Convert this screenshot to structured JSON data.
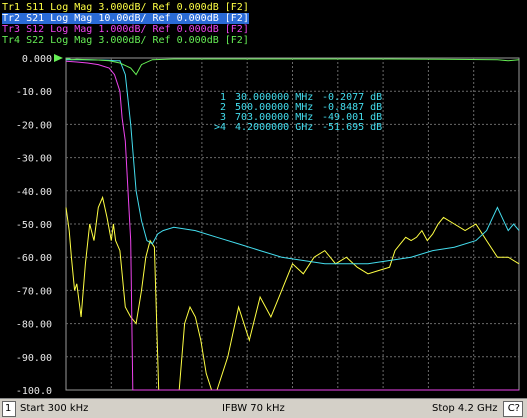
{
  "traces": [
    {
      "label": "Tr1 S11 Log Mag 3.000dB/ Ref 0.000dB [F2]",
      "color": "#ffff44",
      "selected": false
    },
    {
      "label": "Tr2 S21 Log Mag 10.00dB/ Ref 0.000dB [F2]",
      "color": "#44ddee",
      "selected": true
    },
    {
      "label": "Tr3 S12 Log Mag 1.000dB/ Ref 0.000dB [F2]",
      "color": "#ee44ee",
      "selected": false
    },
    {
      "label": "Tr4 S22 Log Mag 3.000dB/ Ref 0.000dB [F2]",
      "color": "#66ee55",
      "selected": false
    }
  ],
  "markers": [
    {
      "number": "1",
      "freq": "30.000000 MHz",
      "value": "-0.2077 dB"
    },
    {
      "number": "2",
      "freq": "500.00000 MHz",
      "value": "-0.8487 dB"
    },
    {
      "number": "3",
      "freq": "703.00000 MHz",
      "value": "-49.001 dB"
    },
    {
      "number": ">4",
      "freq": "4.2000000 GHz",
      "value": "-51.695 dB"
    }
  ],
  "status": {
    "channel": "1",
    "start": "Start 300 kHz",
    "ifbw": "IFBW 70 kHz",
    "stop": "Stop 4.2 GHz",
    "cal": "C?"
  },
  "chart_data": {
    "type": "line",
    "xlim": [
      0.0003,
      4.2
    ],
    "x_unit": "GHz",
    "ylim": [
      -100,
      0
    ],
    "yticks": [
      "0.000",
      "-10.00",
      "-20.00",
      "-30.00",
      "-40.00",
      "-50.00",
      "-60.00",
      "-70.00",
      "-80.00",
      "-90.00",
      "-100.0"
    ],
    "grid": true,
    "series": [
      {
        "name": "S11",
        "color": "#ffff44",
        "x": [
          0.0003,
          0.03,
          0.05,
          0.08,
          0.1,
          0.14,
          0.18,
          0.22,
          0.26,
          0.3,
          0.34,
          0.38,
          0.42,
          0.44,
          0.46,
          0.5,
          0.55,
          0.6,
          0.65,
          0.7,
          0.74,
          0.78,
          0.82,
          0.86,
          0.9,
          0.95,
          1.0,
          1.05,
          1.1,
          1.15,
          1.2,
          1.25,
          1.3,
          1.35,
          1.4,
          1.5,
          1.6,
          1.7,
          1.8,
          1.9,
          2.0,
          2.1,
          2.2,
          2.3,
          2.4,
          2.5,
          2.6,
          2.7,
          2.8,
          2.9,
          3.0,
          3.05,
          3.1,
          3.15,
          3.2,
          3.25,
          3.3,
          3.35,
          3.4,
          3.45,
          3.5,
          3.6,
          3.7,
          3.8,
          3.9,
          4.0,
          4.1,
          4.2
        ],
        "y": [
          -45,
          -52,
          -60,
          -70,
          -68,
          -78,
          -62,
          -50,
          -55,
          -45,
          -42,
          -48,
          -55,
          -50,
          -55,
          -58,
          -75,
          -78,
          -80,
          -70,
          -60,
          -55,
          -57,
          -100,
          -100,
          -100,
          -100,
          -100,
          -80,
          -75,
          -78,
          -85,
          -95,
          -100,
          -100,
          -90,
          -75,
          -85,
          -72,
          -78,
          -70,
          -62,
          -65,
          -60,
          -58,
          -62,
          -60,
          -63,
          -65,
          -64,
          -63,
          -58,
          -56,
          -54,
          -55,
          -54,
          -52,
          -55,
          -53,
          -50,
          -48,
          -50,
          -52,
          -50,
          -55,
          -60,
          -60,
          -62
        ]
      },
      {
        "name": "S21",
        "color": "#44ddee",
        "x": [
          0.0003,
          0.05,
          0.1,
          0.2,
          0.3,
          0.4,
          0.45,
          0.5,
          0.55,
          0.6,
          0.65,
          0.7,
          0.75,
          0.8,
          0.85,
          0.9,
          1.0,
          1.2,
          1.4,
          1.6,
          1.8,
          2.0,
          2.2,
          2.4,
          2.6,
          2.8,
          3.0,
          3.2,
          3.4,
          3.6,
          3.8,
          3.9,
          4.0,
          4.1,
          4.15,
          4.2
        ],
        "y": [
          -0.5,
          -0.5,
          -0.5,
          -0.5,
          -0.6,
          -0.7,
          -0.8,
          -0.85,
          -5,
          -20,
          -40,
          -49,
          -55,
          -56,
          -53,
          -52,
          -51,
          -52,
          -54,
          -56,
          -58,
          -60,
          -61,
          -62,
          -62,
          -62,
          -61,
          -60,
          -58,
          -57,
          -55,
          -52,
          -45,
          -52,
          -50,
          -52
        ]
      },
      {
        "name": "S12",
        "color": "#ee44ee",
        "x": [
          0.0003,
          0.1,
          0.2,
          0.3,
          0.4,
          0.45,
          0.5,
          0.52,
          0.55,
          0.6,
          0.62,
          0.65,
          0.7,
          1.0,
          2.0,
          3.0,
          4.0,
          4.2
        ],
        "y": [
          -1,
          -1.2,
          -1.5,
          -2,
          -3,
          -5,
          -10,
          -18,
          -25,
          -55,
          -100,
          -100,
          -100,
          -100,
          -100,
          -100,
          -100,
          -100
        ]
      },
      {
        "name": "S22",
        "color": "#66ee55",
        "x": [
          0.0003,
          0.03,
          0.05,
          0.1,
          0.2,
          0.3,
          0.4,
          0.5,
          0.6,
          0.65,
          0.7,
          0.8,
          1.0,
          1.5,
          2.0,
          2.5,
          3.0,
          3.5,
          4.0,
          4.1,
          4.2
        ],
        "y": [
          -0.3,
          -0.2,
          -0.5,
          -0.4,
          -0.5,
          -0.6,
          -0.8,
          -1.5,
          -3,
          -5,
          -2,
          -0.5,
          -0.3,
          -0.3,
          -0.3,
          -0.3,
          -0.3,
          -0.4,
          -0.5,
          -0.8,
          -0.5
        ]
      }
    ]
  }
}
